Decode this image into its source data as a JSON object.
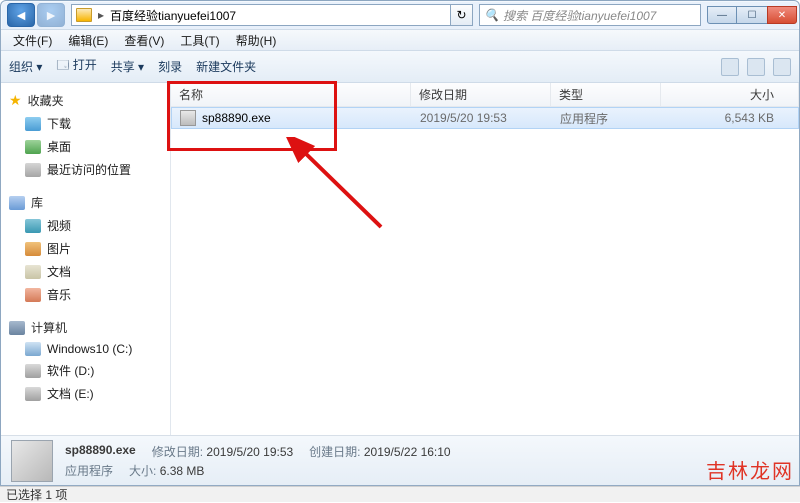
{
  "window": {
    "path_label": "百度经验tianyuefei1007",
    "search_placeholder": "搜索 百度经验tianyuefei1007"
  },
  "menu": {
    "file": "文件(F)",
    "edit": "编辑(E)",
    "view": "查看(V)",
    "tools": "工具(T)",
    "help": "帮助(H)"
  },
  "toolbar": {
    "organize": "组织 ▾",
    "open": "打开",
    "share": "共享 ▾",
    "burn": "刻录",
    "new_folder": "新建文件夹"
  },
  "sidebar": {
    "favorites": "收藏夹",
    "downloads": "下载",
    "desktop": "桌面",
    "recent": "最近访问的位置",
    "libraries": "库",
    "videos": "视频",
    "pictures": "图片",
    "documents": "文档",
    "music": "音乐",
    "computer": "计算机",
    "drive_c": "Windows10 (C:)",
    "drive_d": "软件 (D:)",
    "drive_e": "文档 (E:)"
  },
  "columns": {
    "name": "名称",
    "date": "修改日期",
    "type": "类型",
    "size": "大小"
  },
  "files": [
    {
      "name": "sp88890.exe",
      "date": "2019/5/20 19:53",
      "type": "应用程序",
      "size": "6,543 KB"
    }
  ],
  "details": {
    "filename": "sp88890.exe",
    "type": "应用程序",
    "mod_label": "修改日期:",
    "mod_value": "2019/5/20 19:53",
    "create_label": "创建日期:",
    "create_value": "2019/5/22 16:10",
    "size_label": "大小:",
    "size_value": "6.38 MB"
  },
  "status": "已选择 1 项",
  "watermark": "吉林龙网"
}
